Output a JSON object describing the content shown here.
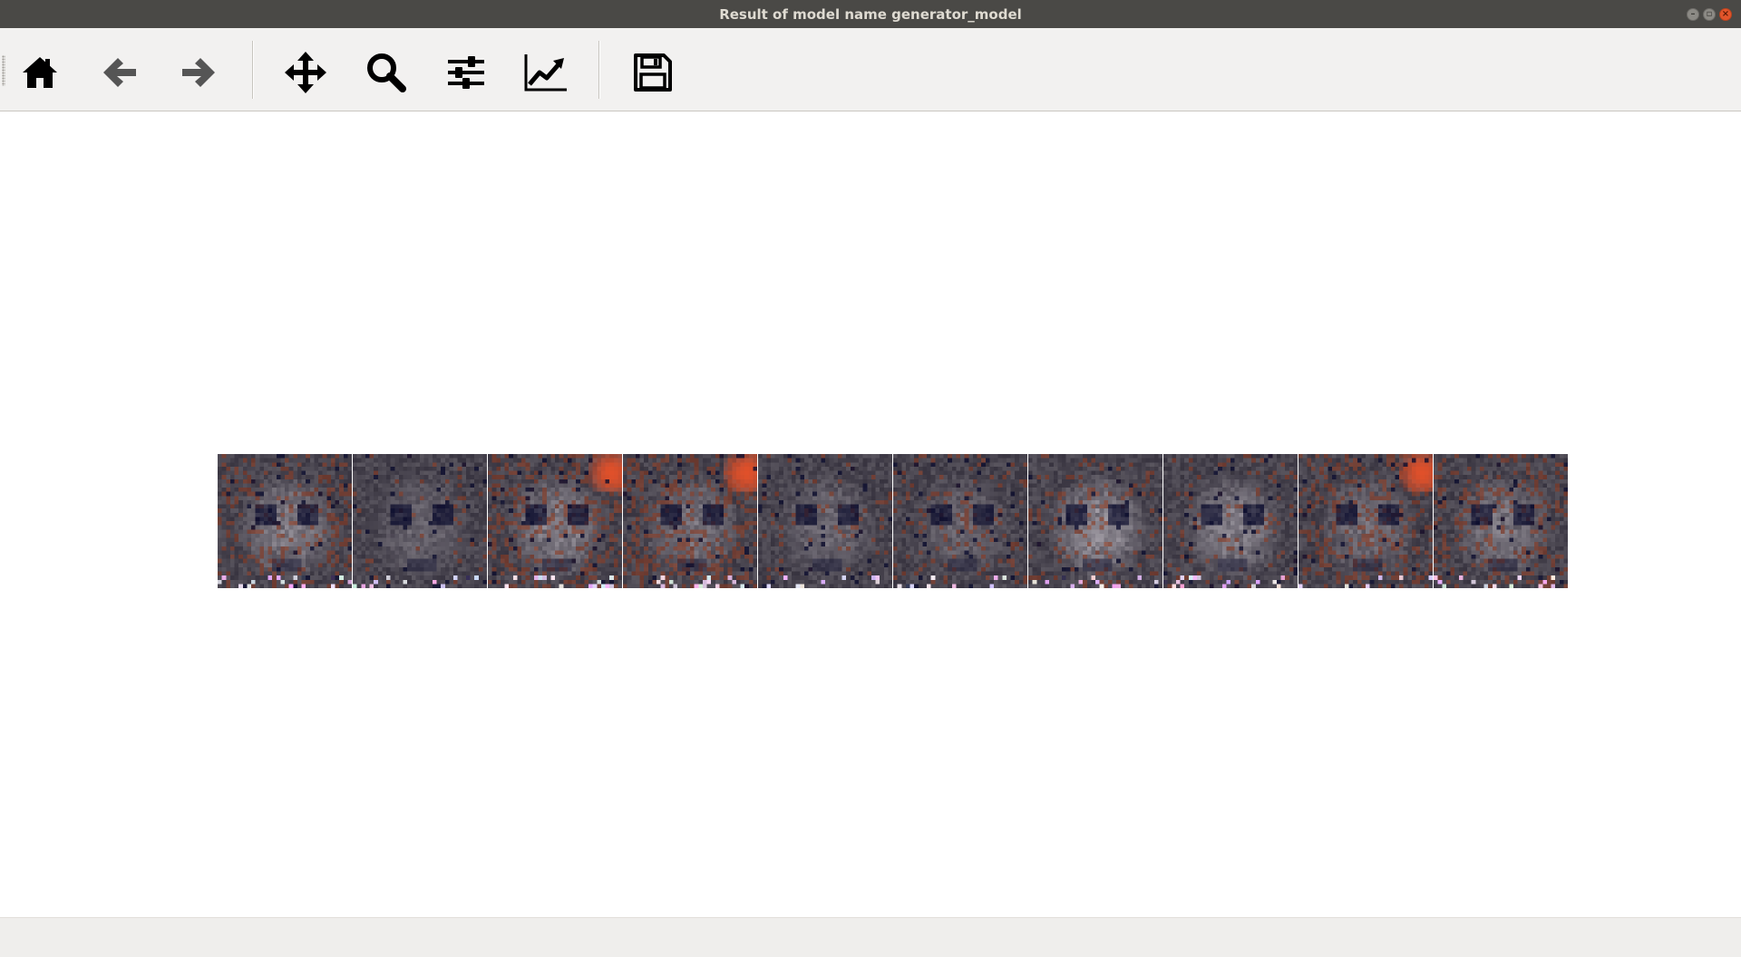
{
  "window": {
    "title": "Result of model name generator_model"
  },
  "toolbar": {
    "buttons": [
      {
        "icon": "home-icon",
        "tooltip": "Home"
      },
      {
        "icon": "back-arrow-icon",
        "tooltip": "Back"
      },
      {
        "icon": "forward-arrow-icon",
        "tooltip": "Forward"
      },
      {
        "icon": "pan-move-icon",
        "tooltip": "Pan"
      },
      {
        "icon": "zoom-magnifier-icon",
        "tooltip": "Zoom"
      },
      {
        "icon": "subplots-sliders-icon",
        "tooltip": "Subplots"
      },
      {
        "icon": "axes-line-chart-icon",
        "tooltip": "Customize"
      },
      {
        "icon": "save-floppy-icon",
        "tooltip": "Save"
      }
    ]
  },
  "figure": {
    "image_count": 10,
    "palette": {
      "dark": "#1a1624",
      "mid_gray": "#6e6a72",
      "light_gray": "#b9b4bc",
      "rust": "#8a3a22",
      "orange": "#e0502a",
      "navy": "#0c0d2e"
    }
  },
  "statusbar": {
    "text": ""
  }
}
